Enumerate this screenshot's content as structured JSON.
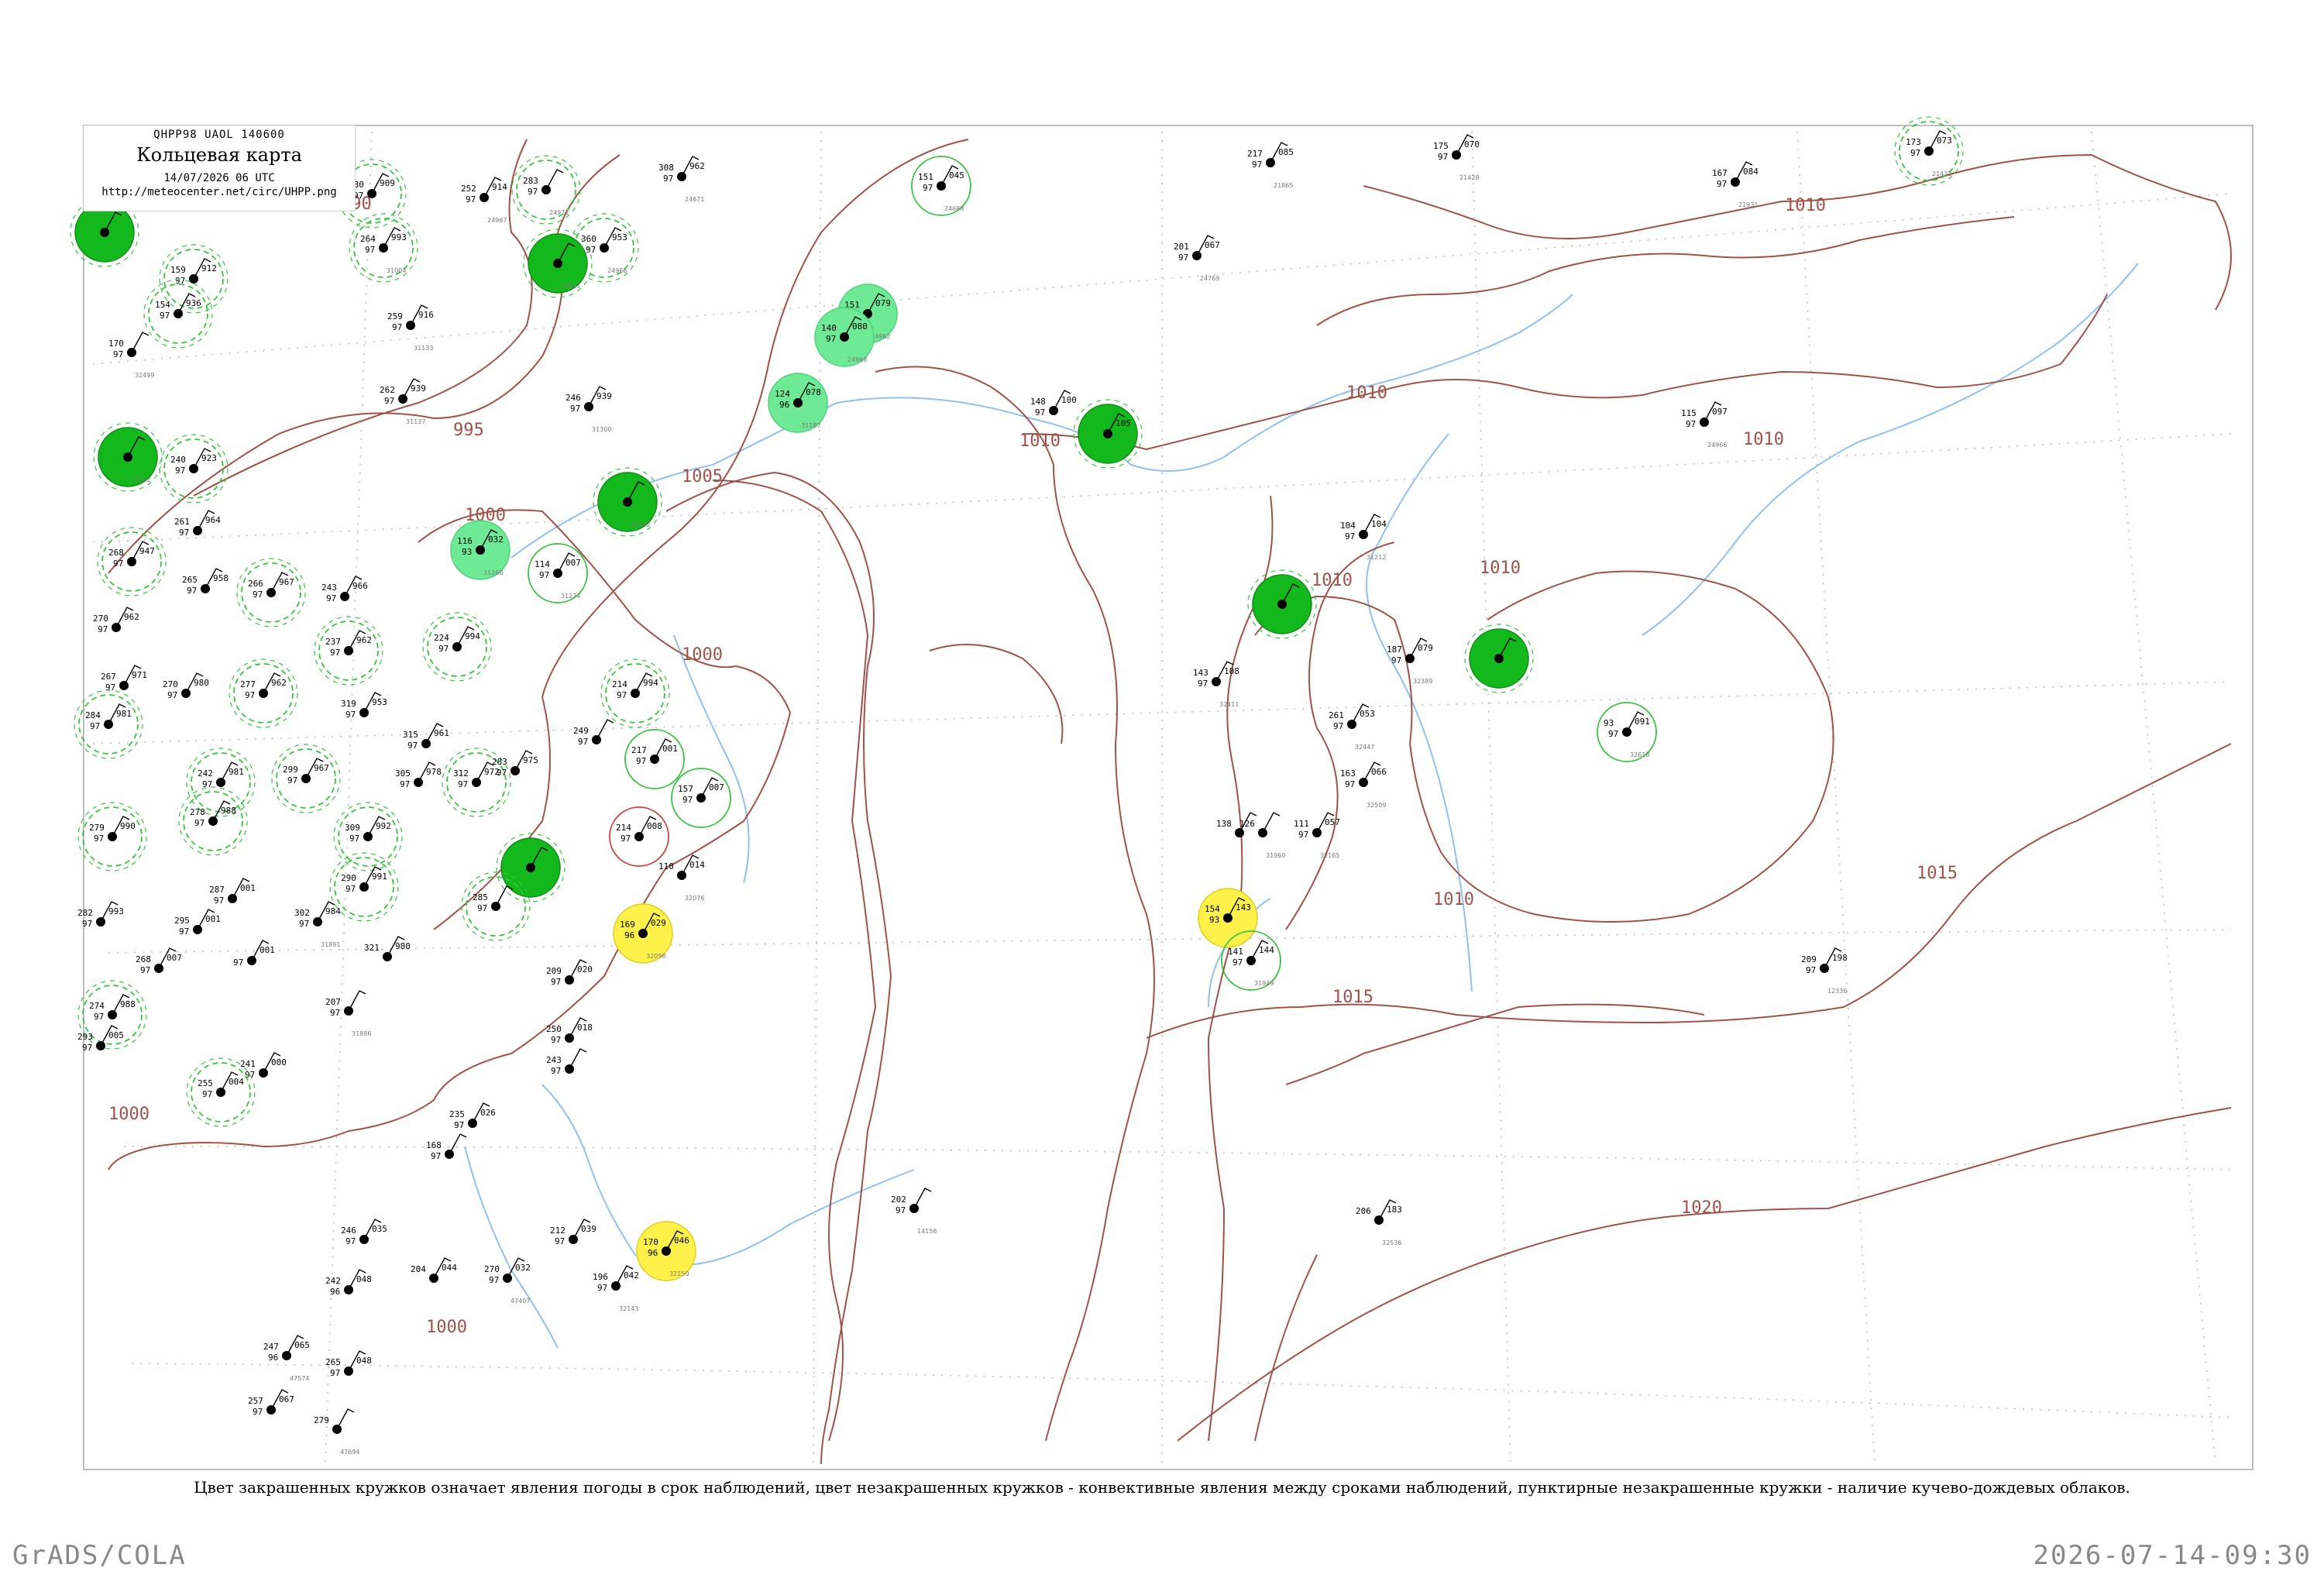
{
  "header": {
    "code": "QHPP98  UAOL  140600",
    "title": "Кольцевая карта",
    "datetime": "14/07/2026 06 UTC",
    "url": "http://meteocenter.net/circ/UHPP.png"
  },
  "caption": "Цвет закрашенных кружков означает явления погоды в срок наблюдений, цвет незакрашенных кружков - конвективные явления между сроками наблюдений, пунктирные незакрашенные кружки - наличие кучево-дождевых облаков.",
  "footer": {
    "left": "GrADS/COLA",
    "right": "2026-07-14-09:30"
  },
  "colors": {
    "isobar": "#a0524a",
    "coast": "#a0524a",
    "river": "#8fc1ea",
    "rain_fill": "#12b81c",
    "shower_fill": "#6ee996",
    "fog_fill": "#fef24a",
    "ring_dashed": "#38c440",
    "ring_red": "#d04040",
    "grid": "#b0b0b0",
    "frame": "#bdbdbd"
  },
  "isobars": [
    {
      "label": "995"
    },
    {
      "label": "1000"
    },
    {
      "label": "1005"
    },
    {
      "label": "1010"
    },
    {
      "label": "1015"
    },
    {
      "label": "1020"
    }
  ],
  "stations": [
    {
      "t": "230",
      "p": "909",
      "d": "97",
      "id": "",
      "ring": "dashed"
    },
    {
      "t": "252",
      "p": "914",
      "d": "97",
      "id": "24967",
      "ring": "none"
    },
    {
      "t": "283",
      "p": "",
      "d": "97",
      "id": "24971",
      "ring": "dashed"
    },
    {
      "t": "308",
      "p": "962",
      "d": "97",
      "id": "24671",
      "ring": "none"
    },
    {
      "t": "151",
      "p": "045",
      "d": "97",
      "id": "24688",
      "ring": "solid"
    },
    {
      "t": "217",
      "p": "085",
      "d": "97",
      "id": "21865",
      "ring": "none"
    },
    {
      "t": "175",
      "p": "070",
      "d": "97",
      "id": "21428",
      "ring": "none"
    },
    {
      "t": "173",
      "p": "073",
      "d": "97",
      "id": "21432",
      "ring": "dashed"
    },
    {
      "t": "167",
      "p": "084",
      "d": "97",
      "id": "21931",
      "ring": "none"
    },
    {
      "t": "264",
      "p": "993",
      "d": "97",
      "id": "31004",
      "ring": "dashed"
    },
    {
      "t": "360",
      "p": "953",
      "d": "97",
      "id": "24966",
      "ring": "dashed"
    },
    {
      "t": "",
      "p": "",
      "d": "",
      "id": "24951",
      "ring": "rain"
    },
    {
      "t": "",
      "p": "",
      "d": "",
      "id": "",
      "ring": "rain"
    },
    {
      "t": "159",
      "p": "912",
      "d": "97",
      "id": "",
      "ring": "dashed"
    },
    {
      "t": "154",
      "p": "936",
      "d": "97",
      "id": "",
      "ring": "dashed"
    },
    {
      "t": "170",
      "p": "",
      "d": "97",
      "id": "32499",
      "ring": "none"
    },
    {
      "t": "259",
      "p": "916",
      "d": "97",
      "id": "31133",
      "ring": "none"
    },
    {
      "t": "151",
      "p": "079",
      "d": "97",
      "id": "24962",
      "ring": "shower"
    },
    {
      "t": "140",
      "p": "080",
      "d": "97",
      "id": "24968",
      "ring": "shower"
    },
    {
      "t": "201",
      "p": "067",
      "d": "97",
      "id": "24769",
      "ring": "none"
    },
    {
      "t": "124",
      "p": "078",
      "d": "96",
      "id": "31187",
      "ring": "shower"
    },
    {
      "t": "148",
      "p": "100",
      "d": "97",
      "id": "",
      "ring": "none"
    },
    {
      "t": "",
      "p": "105",
      "d": "",
      "id": "",
      "ring": "rain"
    },
    {
      "t": "115",
      "p": "097",
      "d": "97",
      "id": "24966",
      "ring": "none"
    },
    {
      "t": "262",
      "p": "939",
      "d": "97",
      "id": "31137",
      "ring": "none"
    },
    {
      "t": "",
      "p": "",
      "d": "",
      "id": "31152",
      "ring": "rain"
    },
    {
      "t": "240",
      "p": "923",
      "d": "97",
      "id": "",
      "ring": "dashed"
    },
    {
      "t": "246",
      "p": "939",
      "d": "97",
      "id": "31300",
      "ring": "none"
    },
    {
      "t": "",
      "p": "",
      "d": "",
      "id": "31102",
      "ring": "rain"
    },
    {
      "t": "116",
      "p": "032",
      "d": "93",
      "id": "31268",
      "ring": "shower"
    },
    {
      "t": "114",
      "p": "007",
      "d": "97",
      "id": "31274",
      "ring": "solid"
    },
    {
      "t": "261",
      "p": "964",
      "d": "97",
      "id": "",
      "ring": "none"
    },
    {
      "t": "268",
      "p": "947",
      "d": "97",
      "id": "",
      "ring": "dashed"
    },
    {
      "t": "265",
      "p": "958",
      "d": "97",
      "id": "",
      "ring": "none"
    },
    {
      "t": "266",
      "p": "967",
      "d": "97",
      "id": "",
      "ring": "dashed"
    },
    {
      "t": "243",
      "p": "966",
      "d": "97",
      "id": "",
      "ring": "none"
    },
    {
      "t": "270",
      "p": "962",
      "d": "97",
      "id": "",
      "ring": "none"
    },
    {
      "t": "237",
      "p": "962",
      "d": "97",
      "id": "",
      "ring": "dashed"
    },
    {
      "t": "224",
      "p": "994",
      "d": "97",
      "id": "",
      "ring": "dashed"
    },
    {
      "t": "104",
      "p": "104",
      "d": "97",
      "id": "31212",
      "ring": "none"
    },
    {
      "t": "",
      "p": "",
      "d": "",
      "id": "",
      "ring": "rain"
    },
    {
      "t": "143",
      "p": "108",
      "d": "97",
      "id": "32411",
      "ring": "none"
    },
    {
      "t": "187",
      "p": "079",
      "d": "97",
      "id": "32389",
      "ring": "none"
    },
    {
      "t": "",
      "p": "",
      "d": "",
      "id": "",
      "ring": "rain"
    },
    {
      "t": "261",
      "p": "053",
      "d": "97",
      "id": "32447",
      "ring": "none"
    },
    {
      "t": "93",
      "p": "091",
      "d": "97",
      "id": "32618",
      "ring": "solid"
    },
    {
      "t": "163",
      "p": "066",
      "d": "97",
      "id": "32509",
      "ring": "none"
    },
    {
      "t": "267",
      "p": "971",
      "d": "97",
      "id": "",
      "ring": "none"
    },
    {
      "t": "270",
      "p": "980",
      "d": "97",
      "id": "",
      "ring": "none"
    },
    {
      "t": "277",
      "p": "962",
      "d": "97",
      "id": "",
      "ring": "dashed"
    },
    {
      "t": "319",
      "p": "953",
      "d": "97",
      "id": "",
      "ring": "none"
    },
    {
      "t": "214",
      "p": "994",
      "d": "97",
      "id": "",
      "ring": "dashed"
    },
    {
      "t": "249",
      "p": "",
      "d": "97",
      "id": "",
      "ring": "none"
    },
    {
      "t": "217",
      "p": "001",
      "d": "97",
      "id": "",
      "ring": "solid"
    },
    {
      "t": "157",
      "p": "007",
      "d": "97",
      "id": "",
      "ring": "solid"
    },
    {
      "t": "284",
      "p": "981",
      "d": "97",
      "id": "",
      "ring": "dashed"
    },
    {
      "t": "315",
      "p": "961",
      "d": "97",
      "id": "",
      "ring": "none"
    },
    {
      "t": "305",
      "p": "978",
      "d": "97",
      "id": "",
      "ring": "none"
    },
    {
      "t": "312",
      "p": "972",
      "d": "97",
      "id": "",
      "ring": "dashed"
    },
    {
      "t": "283",
      "p": "975",
      "d": "97",
      "id": "",
      "ring": "none"
    },
    {
      "t": "242",
      "p": "981",
      "d": "97",
      "id": "",
      "ring": "dashed"
    },
    {
      "t": "299",
      "p": "967",
      "d": "97",
      "id": "",
      "ring": "dashed"
    },
    {
      "t": "278",
      "p": "988",
      "d": "97",
      "id": "",
      "ring": "dashed"
    },
    {
      "t": "279",
      "p": "990",
      "d": "97",
      "id": "",
      "ring": "dashed"
    },
    {
      "t": "309",
      "p": "992",
      "d": "97",
      "id": "",
      "ring": "dashed"
    },
    {
      "t": "214",
      "p": "008",
      "d": "97",
      "id": "",
      "ring": "red"
    },
    {
      "t": "110",
      "p": "014",
      "d": "",
      "id": "32076",
      "ring": "none"
    },
    {
      "t": "138",
      "p": "",
      "d": "",
      "id": "",
      "ring": "none"
    },
    {
      "t": "126",
      "p": "",
      "d": "",
      "id": "31960",
      "ring": "none"
    },
    {
      "t": "111",
      "p": "057",
      "d": "97",
      "id": "32165",
      "ring": "none"
    },
    {
      "t": "",
      "p": "",
      "d": "",
      "id": "",
      "ring": "rain"
    },
    {
      "t": "290",
      "p": "991",
      "d": "97",
      "id": "",
      "ring": "dashed"
    },
    {
      "t": "285",
      "p": "",
      "d": "97",
      "id": "",
      "ring": "dashed"
    },
    {
      "t": "287",
      "p": "001",
      "d": "97",
      "id": "",
      "ring": "none"
    },
    {
      "t": "282",
      "p": "993",
      "d": "97",
      "id": "",
      "ring": "none"
    },
    {
      "t": "295",
      "p": "001",
      "d": "97",
      "id": "",
      "ring": "none"
    },
    {
      "t": "302",
      "p": "984",
      "d": "97",
      "id": "31891",
      "ring": "none"
    },
    {
      "t": "169",
      "p": "029",
      "d": "96",
      "id": "32098",
      "ring": "fog"
    },
    {
      "t": "154",
      "p": "143",
      "d": "93",
      "id": "",
      "ring": "fog"
    },
    {
      "t": "141",
      "p": "144",
      "d": "97",
      "id": "31949",
      "ring": "solid"
    },
    {
      "t": "268",
      "p": "007",
      "d": "97",
      "id": "",
      "ring": "none"
    },
    {
      "t": "",
      "p": "001",
      "d": "97",
      "id": "",
      "ring": "none"
    },
    {
      "t": "321",
      "p": "980",
      "d": "",
      "id": "",
      "ring": "none"
    },
    {
      "t": "209",
      "p": "020",
      "d": "97",
      "id": "",
      "ring": "none"
    },
    {
      "t": "207",
      "p": "",
      "d": "97",
      "id": "31886",
      "ring": "none"
    },
    {
      "t": "274",
      "p": "988",
      "d": "97",
      "id": "",
      "ring": "dashed"
    },
    {
      "t": "293",
      "p": "005",
      "d": "97",
      "id": "",
      "ring": "none"
    },
    {
      "t": "250",
      "p": "018",
      "d": "97",
      "id": "",
      "ring": "none"
    },
    {
      "t": "243",
      "p": "",
      "d": "97",
      "id": "",
      "ring": "none"
    },
    {
      "t": "209",
      "p": "198",
      "d": "97",
      "id": "12336",
      "ring": "none"
    },
    {
      "t": "241",
      "p": "000",
      "d": "97",
      "id": "",
      "ring": "none"
    },
    {
      "t": "255",
      "p": "004",
      "d": "97",
      "id": "",
      "ring": "dashed"
    },
    {
      "t": "235",
      "p": "026",
      "d": "97",
      "id": "",
      "ring": "none"
    },
    {
      "t": "168",
      "p": "",
      "d": "97",
      "id": "",
      "ring": "none"
    },
    {
      "t": "202",
      "p": "",
      "d": "97",
      "id": "14156",
      "ring": "none"
    },
    {
      "t": "206",
      "p": "183",
      "d": "",
      "id": "32536",
      "ring": "none"
    },
    {
      "t": "212",
      "p": "039",
      "d": "97",
      "id": "",
      "ring": "none"
    },
    {
      "t": "170",
      "p": "046",
      "d": "96",
      "id": "32150",
      "ring": "fog"
    },
    {
      "t": "196",
      "p": "042",
      "d": "97",
      "id": "32143",
      "ring": "none"
    },
    {
      "t": "246",
      "p": "035",
      "d": "97",
      "id": "",
      "ring": "none"
    },
    {
      "t": "204",
      "p": "044",
      "d": "",
      "id": "",
      "ring": "none"
    },
    {
      "t": "270",
      "p": "032",
      "d": "97",
      "id": "47407",
      "ring": "none"
    },
    {
      "t": "242",
      "p": "048",
      "d": "96",
      "id": "",
      "ring": "none"
    },
    {
      "t": "247",
      "p": "065",
      "d": "96",
      "id": "47574",
      "ring": "none"
    },
    {
      "t": "265",
      "p": "048",
      "d": "97",
      "id": "",
      "ring": "none"
    },
    {
      "t": "257",
      "p": "067",
      "d": "97",
      "id": "",
      "ring": "none"
    },
    {
      "t": "279",
      "p": "",
      "d": "",
      "id": "47694",
      "ring": "none"
    }
  ]
}
